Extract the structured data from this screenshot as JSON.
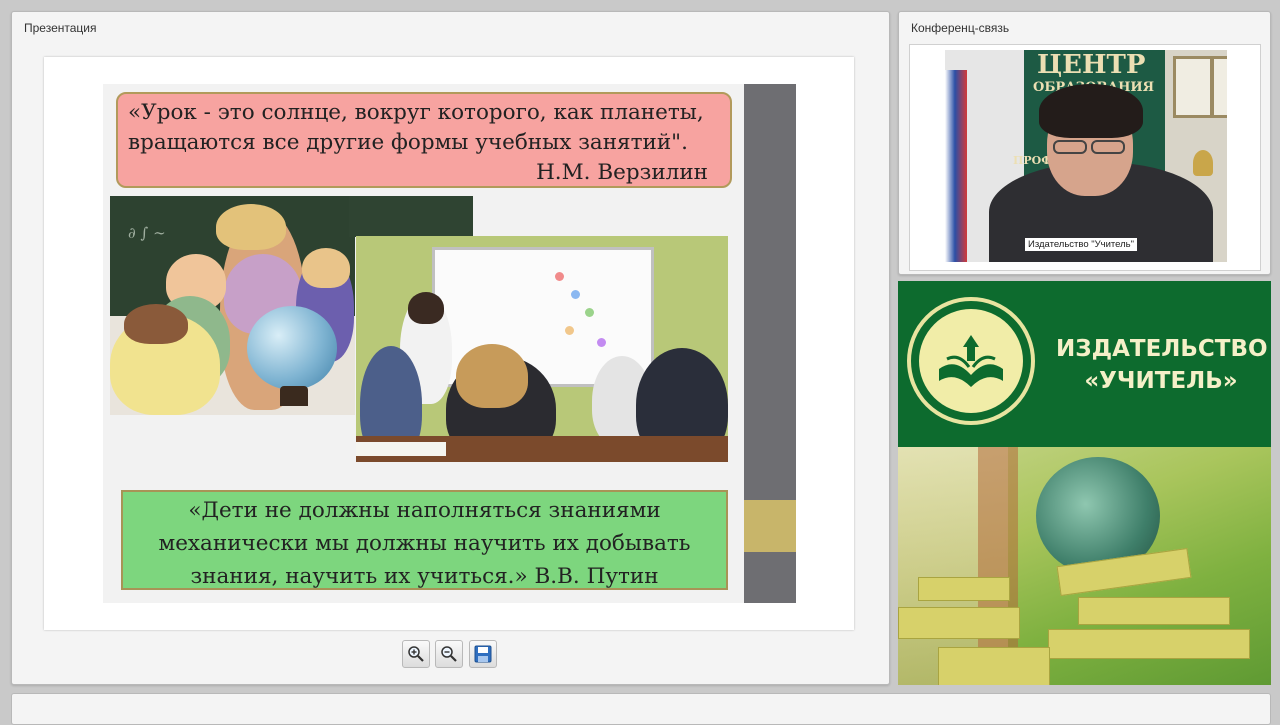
{
  "panels": {
    "presentation_title": "Презентация",
    "conference_title": "Конференц-связь"
  },
  "slide": {
    "quote_top_line1": "«Урок - это солнце, вокруг которого, как планеты,",
    "quote_top_line2": "вращаются все другие формы учебных занятий\".",
    "quote_top_author": "Н.М. Верзилин",
    "quote_bottom_line1": "«Дети не должны наполняться знаниями",
    "quote_bottom_line2": "механически мы должны научить их добывать",
    "quote_bottom_line3": "знания, научить их учиться.»   В.В. Путин"
  },
  "toolbar": {
    "zoom_in_icon": "zoom-in-icon",
    "zoom_out_icon": "zoom-out-icon",
    "save_icon": "save-icon"
  },
  "video": {
    "participant_label": "Издательство \"Учитель\"",
    "background_sign_line1": "ЦЕНТР",
    "background_sign_line2": "ОБРАЗОВАНИЯ",
    "background_sign_line3": "ПРОФ"
  },
  "banner": {
    "publisher_line1": "ИЗДАТЕЛЬСТВО",
    "publisher_line2": "«УЧИТЕЛЬ»"
  },
  "colors": {
    "quote_top_bg": "#f7a3a0",
    "quote_bottom_bg": "#7dd67e",
    "banner_green": "#0d6b2e",
    "slide_bar": "#6e6e72",
    "slide_accent": "#c8b56a"
  }
}
